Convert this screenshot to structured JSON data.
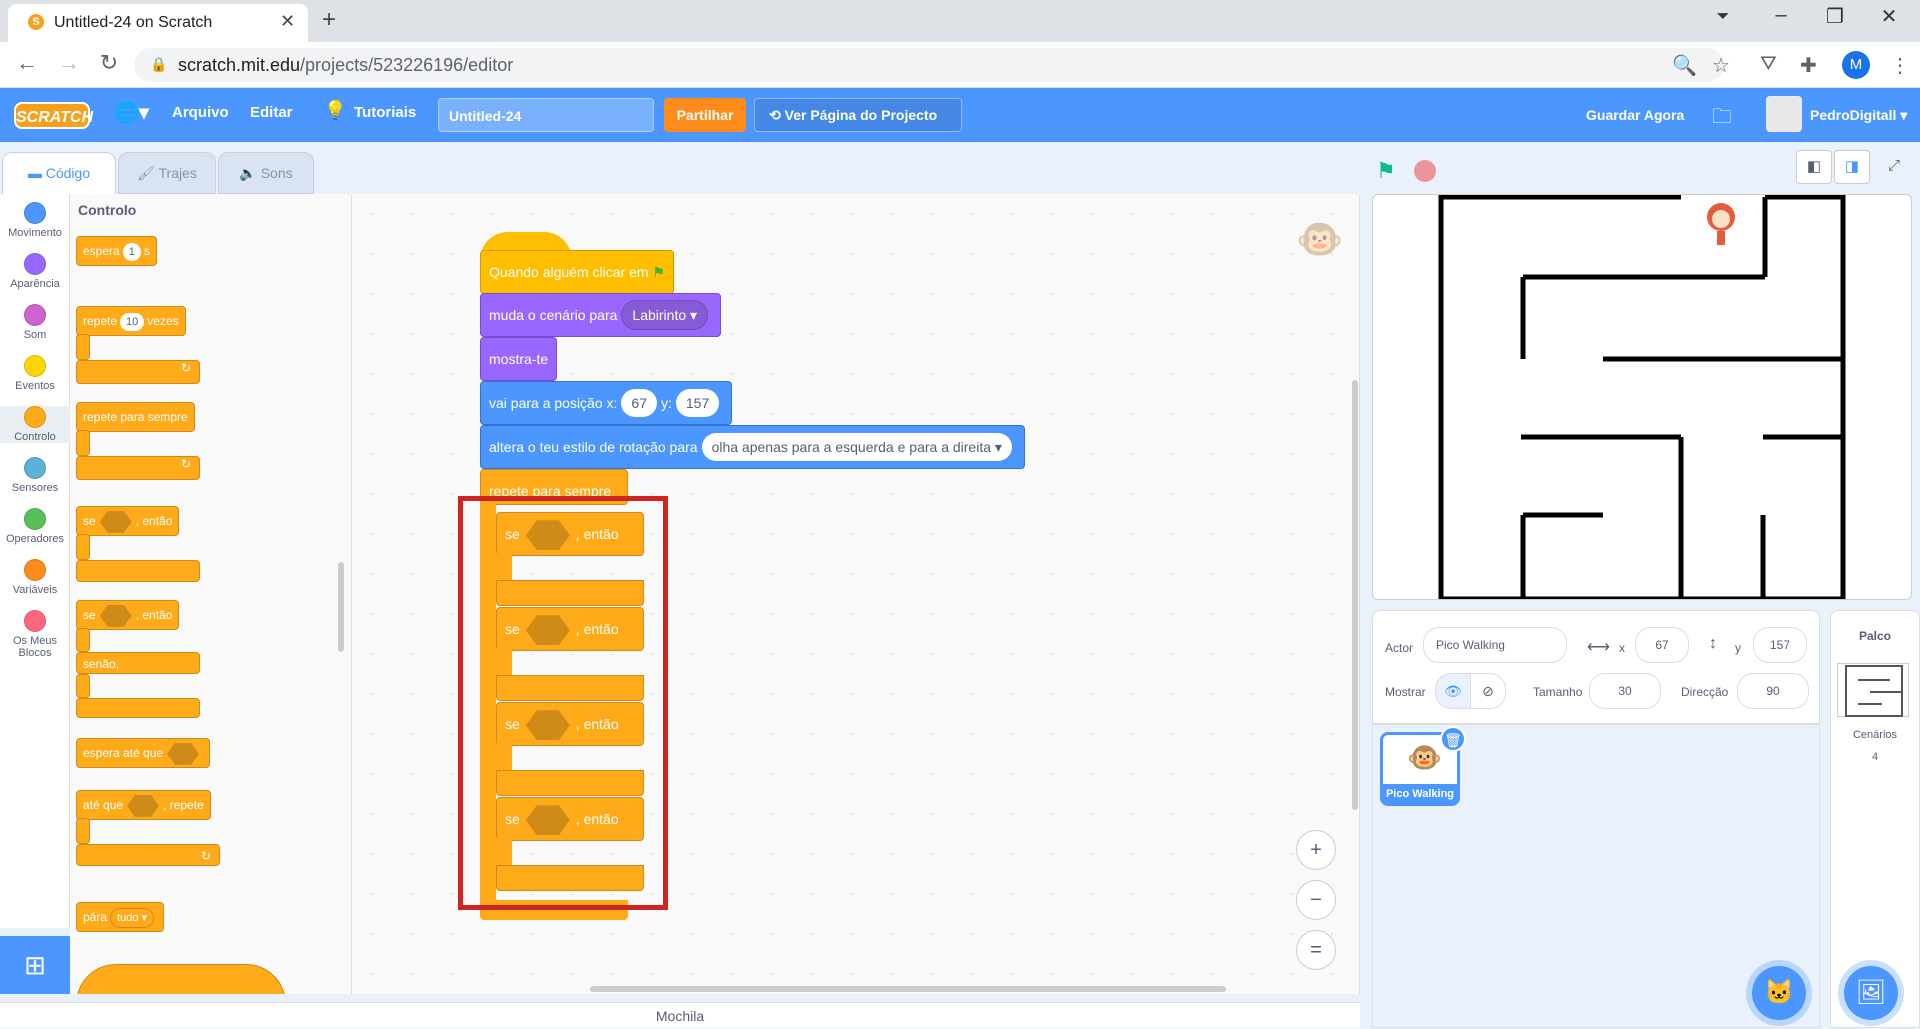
{
  "browser": {
    "tab_title": "Untitled-24 on Scratch",
    "url_host": "scratch.mit.edu",
    "url_path": "/projects/523226196/editor",
    "profile_initial": "M"
  },
  "menubar": {
    "logo": "SCRATCH",
    "file": "Arquivo",
    "edit": "Editar",
    "tutorials": "Tutoriais",
    "project_title": "Untitled-24",
    "share": "Partilhar",
    "see_project": "Ver Página do Projecto",
    "save_now": "Guardar Agora",
    "username": "PedroDigitall"
  },
  "editor_tabs": {
    "code": "Código",
    "costumes": "Trajes",
    "sounds": "Sons"
  },
  "categories": [
    {
      "label": "Movimento",
      "color": "#4c97ff"
    },
    {
      "label": "Aparência",
      "color": "#9966ff"
    },
    {
      "label": "Som",
      "color": "#cf63cf"
    },
    {
      "label": "Eventos",
      "color": "#ffd500"
    },
    {
      "label": "Controlo",
      "color": "#ffab19"
    },
    {
      "label": "Sensores",
      "color": "#5cb1d6"
    },
    {
      "label": "Operadores",
      "color": "#59c059"
    },
    {
      "label": "Variáveis",
      "color": "#ff8c1a"
    },
    {
      "label": "Os Meus Blocos",
      "color": "#ff6680"
    }
  ],
  "palette": {
    "heading": "Controlo",
    "wait": "espera",
    "wait_val": "1",
    "wait_unit": "s",
    "repeat": "repete",
    "repeat_val": "10",
    "repeat_unit": "vezes",
    "forever": "repete para sempre",
    "if": "se",
    "then": ", então",
    "else": "senão,",
    "wait_until": "espera até que",
    "until": "até que",
    "until_repeat": ", repete",
    "stop": "pára",
    "stop_val": "tudo"
  },
  "script": {
    "when_flag": "Quando alguém clicar em",
    "switch_backdrop": "muda o cenário para",
    "backdrop_val": "Labirinto",
    "show": "mostra-te",
    "goto": "vai para a posição x:",
    "goto_x": "67",
    "goto_y_label": "y:",
    "goto_y": "157",
    "rotation": "altera o teu estilo de rotação para",
    "rotation_val": "olha apenas para a esquerda e para a direita",
    "forever": "repete para sempre",
    "if": "se",
    "then": ", então"
  },
  "zoom": {
    "in": "+",
    "out": "−",
    "reset": "="
  },
  "backpack": "Mochila",
  "sprite_info": {
    "sprite_label": "Actor",
    "sprite_name": "Pico Walking",
    "x_label": "x",
    "x": "67",
    "y_label": "y",
    "y": "157",
    "show_label": "Mostrar",
    "size_label": "Tamanho",
    "size": "30",
    "direction_label": "Direcção",
    "direction": "90"
  },
  "sprite_card": "Pico Walking",
  "stage_panel": {
    "title": "Palco",
    "backdrops_label": "Cenários",
    "backdrops_count": "4"
  },
  "colors": {
    "scratch_blue": "#4c97ff",
    "control": "#ffab19",
    "looks": "#9966ff",
    "motion": "#4c97ff",
    "highlight": "#d22323"
  }
}
